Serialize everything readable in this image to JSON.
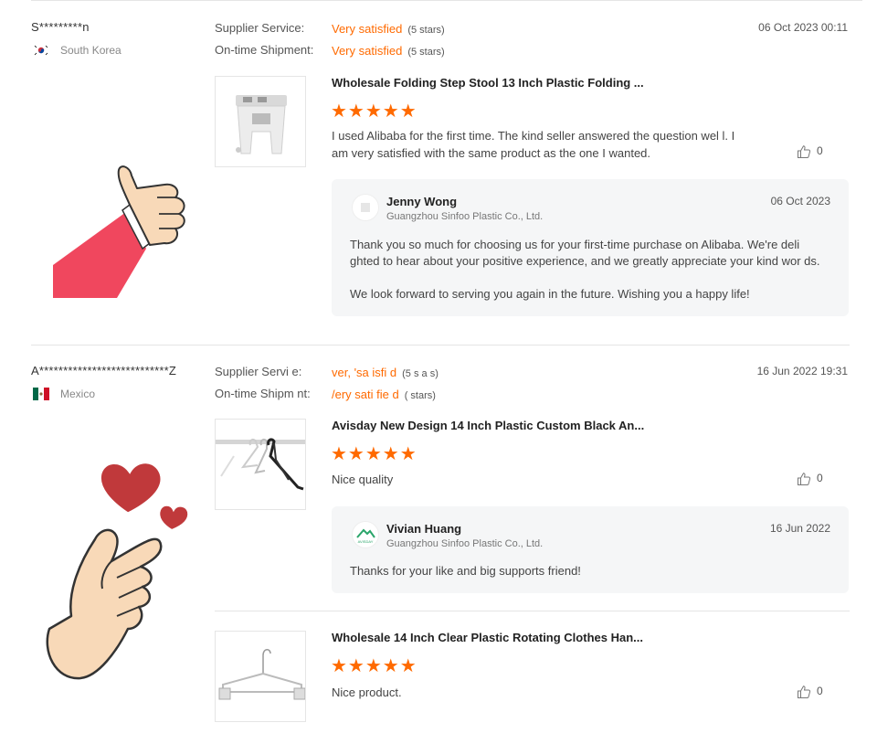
{
  "reviews": [
    {
      "user": "S*********n",
      "country": "South Korea",
      "flag_icon": "south-korea-flag-icon",
      "supplier_service_label": "Supplier Service:",
      "supplier_service_value": "Very satisfied",
      "supplier_service_stars": "(5 stars)",
      "shipment_label": "On-time Shipment:",
      "shipment_value": "Very satisfied",
      "shipment_stars": "(5 stars)",
      "date": "06 Oct 2023 00:11",
      "product_title": "Wholesale Folding Step Stool 13 Inch Plastic Folding ...",
      "rating": "★★★★★",
      "text": "I used Alibaba for the first time. The kind seller answered the question wel l. I am very satisfied with the same product as the one I wanted.",
      "likes": "0",
      "reply": {
        "name": "Jenny Wong",
        "company": "Guangzhou Sinfoo Plastic Co., Ltd.",
        "date": "06 Oct 2023",
        "text_1": "Thank you so much for choosing us for your first-time purchase on Alibaba. We're deli ghted to hear about your positive experience, and we greatly appreciate your kind wor ds.",
        "text_2": "We look forward to serving you again in the future. Wishing you a happy life!"
      }
    },
    {
      "user": "A***************************Z",
      "country": "Mexico",
      "flag_icon": "mexico-flag-icon",
      "supplier_service_label": "Supplier Servi e:",
      "supplier_service_value": "ver, 'sa isfi d",
      "supplier_service_stars": "(5 s a s)",
      "shipment_label": "On-time Shipm nt:",
      "shipment_value": "/ery sati fie d",
      "shipment_stars": "( stars)",
      "date": "16 Jun 2022 19:31",
      "product_title": "Avisday New Design 14 Inch Plastic Custom Black An...",
      "rating": "★★★★★",
      "text": "Nice quality",
      "likes": "0",
      "reply": {
        "name": "Vivian Huang",
        "company": "Guangzhou Sinfoo Plastic Co., Ltd.",
        "date": "16 Jun 2022",
        "text_1": "Thanks for your like and big supports friend!",
        "logo_text": "AVISDAY"
      },
      "second_product": {
        "product_title": "Wholesale 14 Inch Clear Plastic Rotating Clothes Han...",
        "rating": "★★★★★",
        "text": "Nice product.",
        "likes": "0"
      }
    }
  ],
  "colors": {
    "accent": "#ff6a00",
    "reply_bg": "#f5f6f7",
    "divider": "#e5e5e5",
    "sleeve": "#f0475e",
    "heart": "#c0393b",
    "skin": "#f8d9b8"
  },
  "stickers": [
    "thumbs-up-sticker",
    "finger-heart-sticker"
  ]
}
